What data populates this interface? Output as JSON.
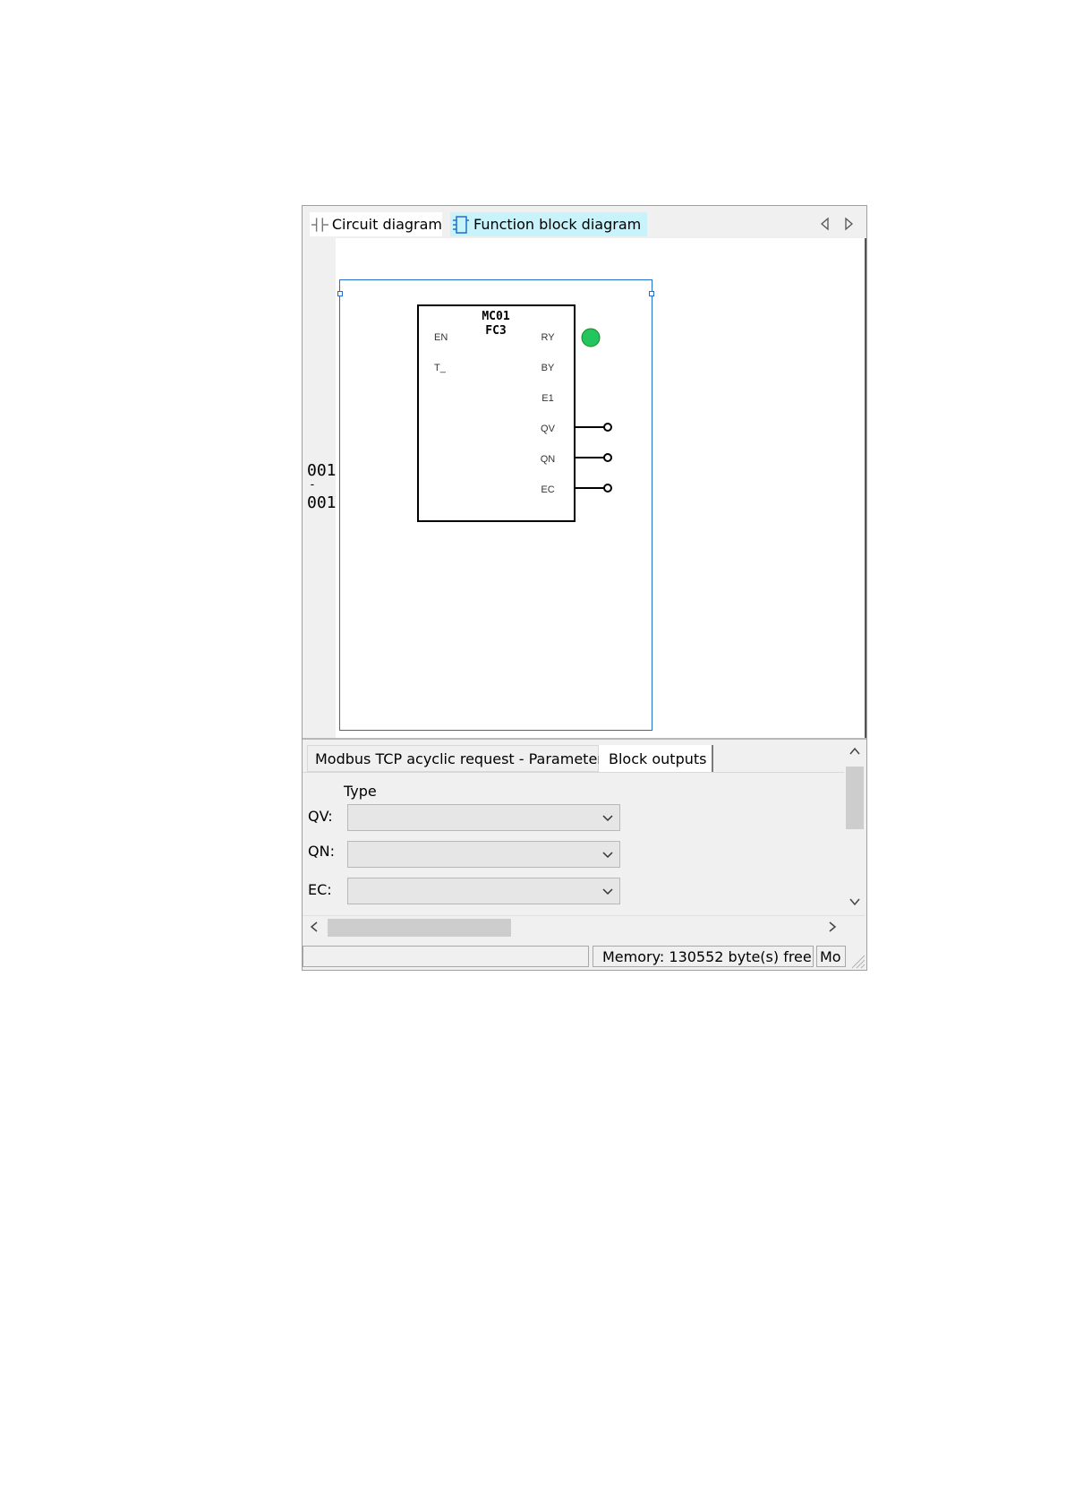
{
  "tabs": {
    "circuit_diagram": "Circuit diagram",
    "function_block_diagram": "Function block diagram"
  },
  "ruler": {
    "top": "001",
    "separator": "-",
    "bottom": "001"
  },
  "block": {
    "name": "MC01",
    "function": "FC3",
    "inputs": [
      "EN",
      "T_"
    ],
    "outputs": [
      "RY",
      "BY",
      "E1",
      "QV",
      "QN",
      "EC"
    ],
    "status_led_color": "#22c55e"
  },
  "panel": {
    "tabs": {
      "parameter": "Modbus TCP acyclic request - Parameter",
      "block_outputs": "Block outputs"
    },
    "type_header": "Type",
    "rows": [
      {
        "label": "QV:",
        "value": ""
      },
      {
        "label": "QN:",
        "value": ""
      },
      {
        "label": "EC:",
        "value": ""
      }
    ]
  },
  "status": {
    "memory": "Memory: 130552 byte(s) free",
    "mode": "Mo"
  },
  "colors": {
    "active_tab": "#c9f3fb",
    "selection": "#1e6fd0"
  }
}
